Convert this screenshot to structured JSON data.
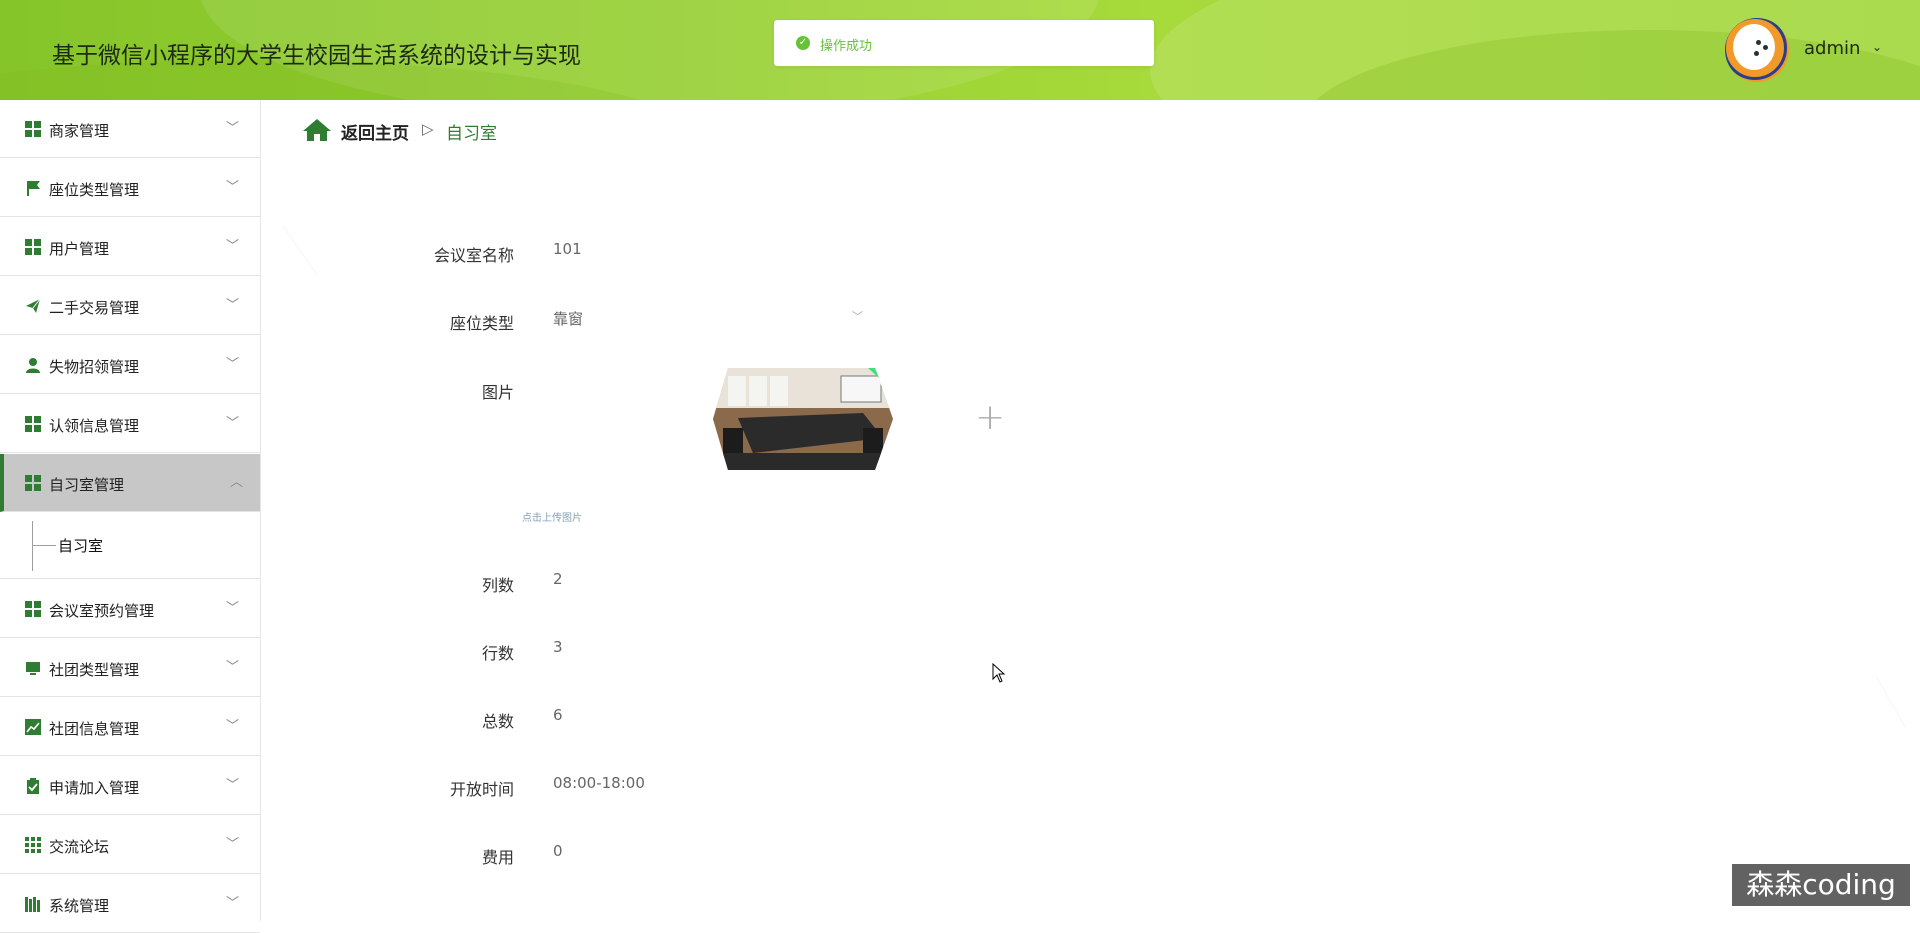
{
  "header": {
    "app_title": "基于微信小程序的大学生校园生活系统的设计与实现",
    "toast": "操作成功",
    "user": "admin"
  },
  "sidebar": {
    "items": [
      {
        "label": "商家管理",
        "icon": "grid-icon"
      },
      {
        "label": "座位类型管理",
        "icon": "flag-icon"
      },
      {
        "label": "用户管理",
        "icon": "grid-icon"
      },
      {
        "label": "二手交易管理",
        "icon": "paper-plane-icon"
      },
      {
        "label": "失物招领管理",
        "icon": "user-icon"
      },
      {
        "label": "认领信息管理",
        "icon": "grid-icon"
      },
      {
        "label": "自习室管理",
        "icon": "grid-icon",
        "active": true
      },
      {
        "label": "会议室预约管理",
        "icon": "grid-icon"
      },
      {
        "label": "社团类型管理",
        "icon": "monitor-icon"
      },
      {
        "label": "社团信息管理",
        "icon": "chart-icon"
      },
      {
        "label": "申请加入管理",
        "icon": "clipboard-check-icon"
      },
      {
        "label": "交流论坛",
        "icon": "grid9-icon"
      },
      {
        "label": "系统管理",
        "icon": "bars-icon"
      }
    ],
    "submenu": {
      "label": "自习室"
    }
  },
  "breadcrumb": {
    "home": "返回主页",
    "separator": "▷",
    "current": "自习室"
  },
  "form": {
    "name_label": "会议室名称",
    "name_value": "101",
    "seat_type_label": "座位类型",
    "seat_type_value": "靠窗",
    "image_label": "图片",
    "upload_hint": "点击上传图片",
    "columns_label": "列数",
    "columns_value": "2",
    "rows_label": "行数",
    "rows_value": "3",
    "total_label": "总数",
    "total_value": "6",
    "open_time_label": "开放时间",
    "open_time_value": "08:00-18:00",
    "fee_label": "费用",
    "fee_value": "0"
  },
  "watermark": "森森coding",
  "colors": {
    "header_green": "#95cf30",
    "accent_green": "#2e7d32",
    "success": "#67c23a"
  }
}
